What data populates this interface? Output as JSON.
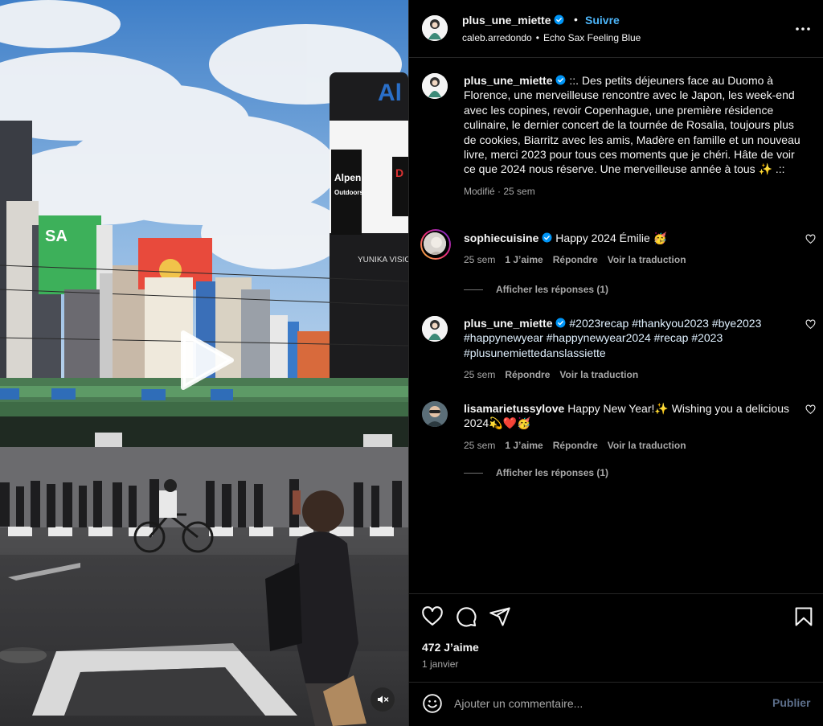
{
  "post": {
    "username": "plus_une_miette",
    "follow_label": "Suivre",
    "dot": "•",
    "audio_user": "caleb.arredondo",
    "audio_sep": "•",
    "audio_track": "Echo Sax Feeling Blue",
    "caption": "::. Des petits déjeuners face au Duomo à Florence, une merveilleuse rencontre avec le Japon, les week-end avec les copines, revoir Copenhague, une première résidence culinaire, le dernier concert de la tournée de Rosalia, toujours plus de cookies, Biarritz avec les amis, Madère en famille et un nouveau livre, merci 2023 pour tous ces moments que je chéri. Hâte de voir ce que 2024 nous réserve. Une merveilleuse année à tous ✨ .::",
    "caption_meta": "Modifié · 25 sem",
    "likes": "472 J’aime",
    "date": "1 janvier"
  },
  "comments": [
    {
      "username": "sophiecuisine",
      "text": "Happy 2024 Émilie 🥳",
      "time": "25 sem",
      "likes": "1 J’aime",
      "reply": "Répondre",
      "translate": "Voir la traduction",
      "replies": "Afficher les réponses (1)"
    },
    {
      "username": "plus_une_miette",
      "text": "#2023recap #thankyou2023 #bye2023 #happynewyear #happynewyear2024 #recap #2023 #plusunemiettedanslassiette",
      "time": "25 sem",
      "reply": "Répondre",
      "translate": "Voir la traduction"
    },
    {
      "username": "lisamarietussylove",
      "text": "Happy New Year!✨ Wishing you a delicious 2024💫❤️🥳",
      "time": "25 sem",
      "likes": "1 J’aime",
      "reply": "Répondre",
      "translate": "Voir la traduction",
      "replies": "Afficher les réponses (1)"
    }
  ],
  "scene": {
    "sign_alpen": "Alpen",
    "sign_outdoors": "Outdoors",
    "sign_yunika": "YUNIKA VISION",
    "sign_al": "Al",
    "sign_d": "D",
    "sign_sa": "SA"
  },
  "composer": {
    "placeholder": "Ajouter un commentaire...",
    "publish_label": "Publier"
  },
  "colors": {
    "accent": "#4cb5f9",
    "verified": "#0095f6",
    "muted": "#a8a8a8",
    "background": "#000000"
  }
}
